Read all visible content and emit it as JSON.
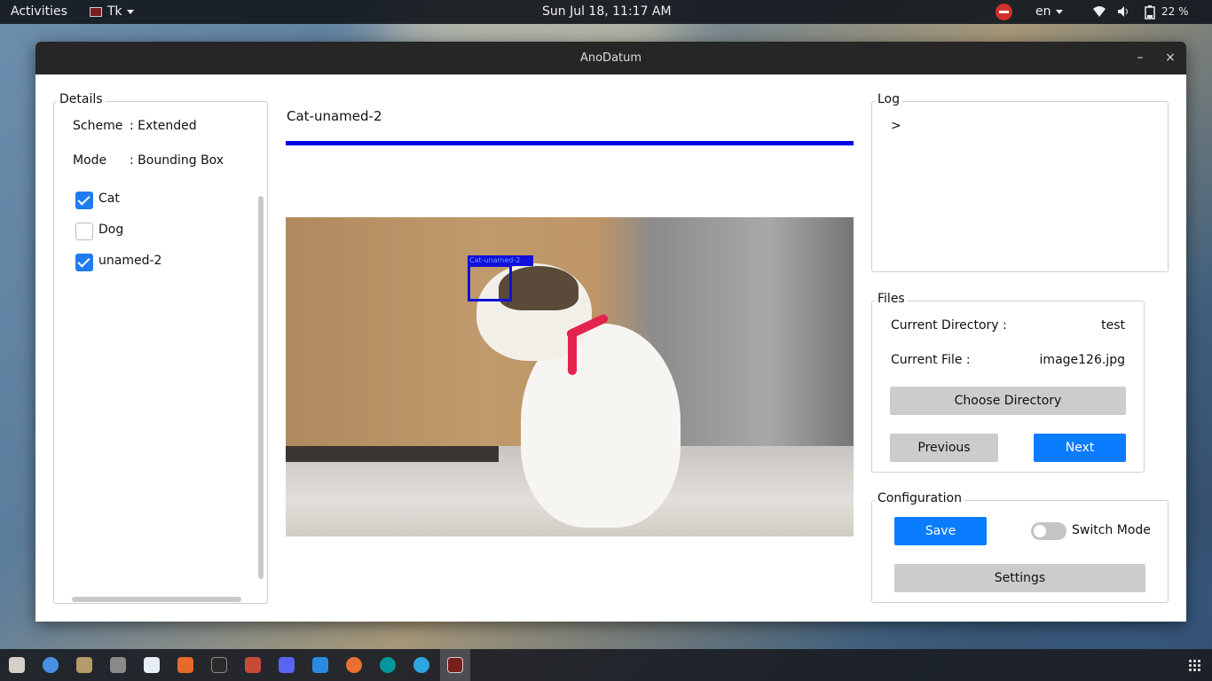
{
  "topbar": {
    "activities": "Activities",
    "app_menu": "Tk",
    "clock": "Sun Jul 18, 11:17 AM",
    "language": "en",
    "battery": "22 %"
  },
  "window": {
    "title": "AnoDatum",
    "minimize": "–",
    "close": "×"
  },
  "details": {
    "title": "Details",
    "scheme_label": "Scheme",
    "scheme_value": ": Extended",
    "mode_label": "Mode",
    "mode_value": ": Bounding Box",
    "classes": [
      {
        "label": "Cat",
        "checked": true
      },
      {
        "label": "Dog",
        "checked": false
      },
      {
        "label": "unamed-2",
        "checked": true
      }
    ]
  },
  "canvas": {
    "heading": "Cat-unamed-2",
    "progress": 1.0,
    "bbox_tag": "Cat-unamed-2",
    "bbox_color": "#1010d8"
  },
  "log": {
    "title": "Log",
    "prompt": ">"
  },
  "files": {
    "title": "Files",
    "dir_label": "Current Directory :",
    "dir_value": "test",
    "file_label": "Current File :",
    "file_value": "image126.jpg",
    "choose_dir": "Choose Directory",
    "previous": "Previous",
    "next": "Next"
  },
  "config": {
    "title": "Configuration",
    "save": "Save",
    "switch_mode": "Switch Mode",
    "settings": "Settings"
  },
  "colors": {
    "accent": "#0a7cff",
    "checkbox": "#1e7cf0",
    "progress": "#0000e8"
  },
  "dock": {
    "icons": [
      "files-icon",
      "chromium-icon",
      "gimp-icon",
      "calculator-icon",
      "text-editor-icon",
      "software-center-icon",
      "terminal-icon",
      "settings-tools-icon",
      "discord-icon",
      "vscode-icon",
      "ubuntu-icon",
      "arduino-icon",
      "telegram-icon",
      "tk-app-icon"
    ]
  }
}
